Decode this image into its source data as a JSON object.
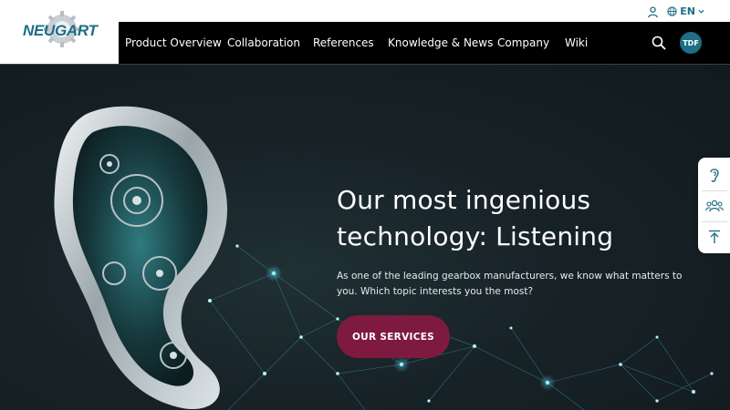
{
  "brand": {
    "logo_text": "NEUGART",
    "accent": "#1d6e86",
    "cta_color": "#7e1a3f"
  },
  "utility": {
    "language": "EN"
  },
  "nav": {
    "items": [
      {
        "label": "Product Overview"
      },
      {
        "label": "Collaboration"
      },
      {
        "label": "References"
      },
      {
        "label": "Knowledge & News"
      },
      {
        "label": "Company"
      },
      {
        "label": "Wiki"
      }
    ],
    "avatar": "TDF"
  },
  "hero": {
    "title_line1": "Our most ingenious",
    "title_line2": "technology: Listening",
    "text": "As one of the leading gearbox manufacturers, we know what matters to you. Which topic interests you the most?",
    "cta": "OUR SERVICES"
  },
  "side_panel": {
    "icons": [
      "ear-icon",
      "group-icon",
      "scroll-top-icon"
    ]
  }
}
